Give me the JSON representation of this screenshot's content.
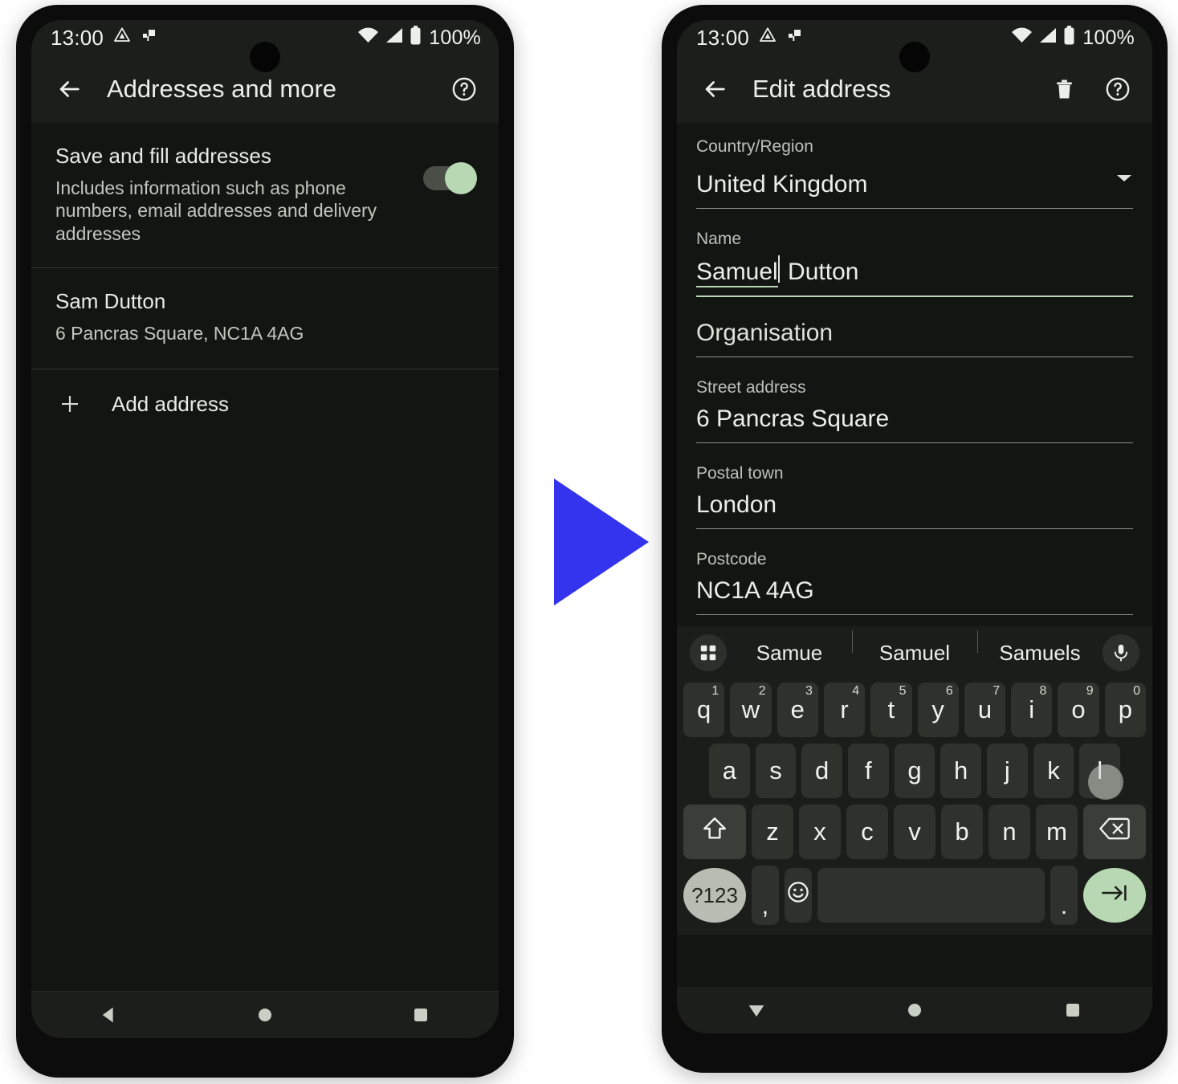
{
  "status_bar": {
    "time": "13:00",
    "battery_percent": "100%",
    "icons": [
      "warning-triangle-icon",
      "cast-icon",
      "wifi-icon",
      "signal-icon",
      "battery-icon"
    ]
  },
  "left_phone": {
    "appbar": {
      "back_icon": "arrow-left-icon",
      "title": "Addresses and more",
      "help_icon": "help-circle-icon"
    },
    "save_fill_setting": {
      "title": "Save and fill addresses",
      "description": "Includes information such as phone numbers, email addresses and delivery addresses",
      "toggle_state": "on"
    },
    "saved_address": {
      "name": "Sam Dutton",
      "line": "6 Pancras Square, NC1A 4AG"
    },
    "add_address": {
      "plus_icon": "plus-icon",
      "label": "Add address"
    },
    "navbar": [
      "back-triangle-icon",
      "home-circle-icon",
      "recents-square-icon"
    ]
  },
  "right_phone": {
    "appbar": {
      "back_icon": "arrow-left-icon",
      "title": "Edit address",
      "delete_icon": "trash-icon",
      "help_icon": "help-circle-icon"
    },
    "fields": [
      {
        "label": "Country/Region",
        "value": "United Kingdom",
        "type": "dropdown",
        "placeholder": ""
      },
      {
        "label": "Name",
        "value": "Samuel",
        "trailing": " Dutton",
        "type": "text-focused",
        "placeholder": "Name"
      },
      {
        "label": "",
        "value": "Organisation",
        "type": "empty",
        "placeholder": "Organisation"
      },
      {
        "label": "Street address",
        "value": "6 Pancras Square",
        "type": "text",
        "placeholder": "Street address"
      },
      {
        "label": "Postal town",
        "value": "London",
        "type": "text",
        "placeholder": "Postal town"
      },
      {
        "label": "Postcode",
        "value": "NC1A 4AG",
        "type": "text",
        "placeholder": "Postcode"
      }
    ],
    "keyboard": {
      "suggestions": [
        "Samue",
        "Samuel",
        "Samuels"
      ],
      "grid_icon": "apps-grid-icon",
      "mic_icon": "microphone-icon",
      "row1": [
        {
          "key": "q",
          "sup": "1"
        },
        {
          "key": "w",
          "sup": "2"
        },
        {
          "key": "e",
          "sup": "3"
        },
        {
          "key": "r",
          "sup": "4"
        },
        {
          "key": "t",
          "sup": "5"
        },
        {
          "key": "y",
          "sup": "6"
        },
        {
          "key": "u",
          "sup": "7"
        },
        {
          "key": "i",
          "sup": "8"
        },
        {
          "key": "o",
          "sup": "9"
        },
        {
          "key": "p",
          "sup": "0"
        }
      ],
      "row2": [
        "a",
        "s",
        "d",
        "f",
        "g",
        "h",
        "j",
        "k",
        "l"
      ],
      "row3": [
        "z",
        "x",
        "c",
        "v",
        "b",
        "n",
        "m"
      ],
      "shift_icon": "shift-up-icon",
      "backspace_icon": "backspace-icon",
      "symbols_key": "?123",
      "comma_key": ",",
      "emoji_icon": "emoji-smiley-icon",
      "space_key": "",
      "period_key": ".",
      "enter_icon": "tab-next-arrow-icon",
      "pressed_key": "l"
    },
    "navbar": [
      "hide-keyboard-down-icon",
      "home-circle-icon",
      "recents-square-icon"
    ]
  },
  "transition_arrow": {
    "name": "blue-right-arrow",
    "color": "#3434ee"
  }
}
